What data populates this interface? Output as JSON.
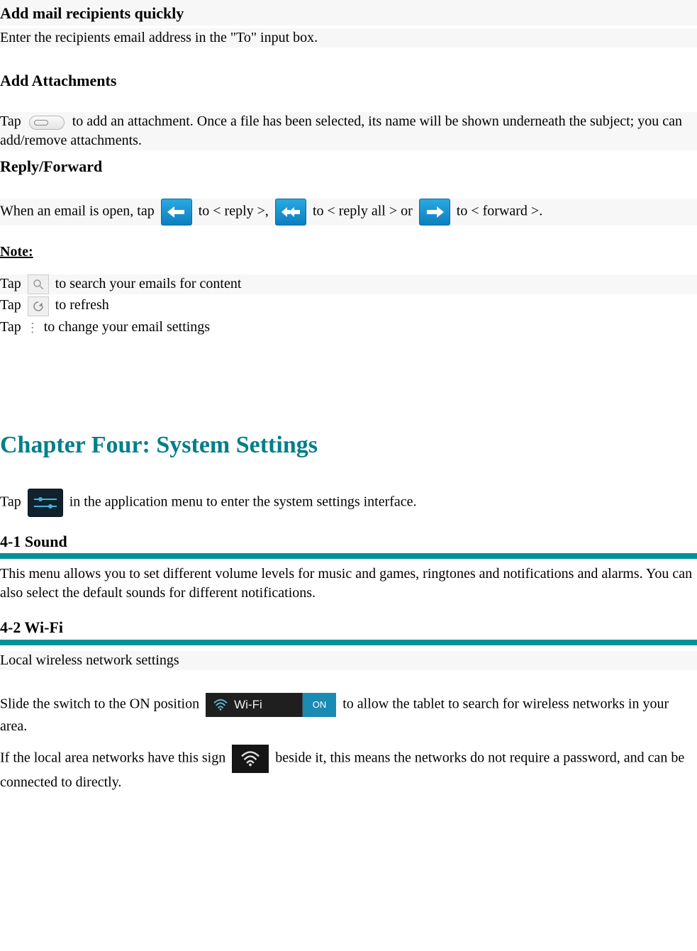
{
  "email": {
    "add_recipients_heading": "Add mail recipients quickly",
    "add_recipients_body": "Enter the recipients email address in the \"To\" input box.",
    "add_attachments_heading": "Add Attachments",
    "attach_pre": "Tap ",
    "attach_post": " to add an attachment. Once a file has been selected, its name will be shown underneath the subject; you can add/remove attachments.",
    "reply_forward_heading": "Reply/Forward",
    "reply_pre": "When an email is open, tap ",
    "reply_mid1": " to < reply >, ",
    "reply_mid2": " to < reply all > or ",
    "reply_post": " to < forward >.",
    "note_heading": "Note:",
    "note_search_pre": "Tap ",
    "note_search_post": " to search your emails for content",
    "note_refresh_pre": "Tap ",
    "note_refresh_post": " to refresh",
    "note_settings_pre": "Tap ",
    "note_settings_post": " to change your email settings"
  },
  "chapter": {
    "title": "Chapter Four: System Settings",
    "intro_pre": "Tap ",
    "intro_post": " in the application menu to enter the system settings interface.",
    "sound_heading": "4-1 Sound",
    "sound_body": "This menu allows you to set different volume levels for music and games, ringtones and notifications and alarms.    You can also select the default sounds for different notifications.",
    "wifi_heading": "4-2 Wi-Fi",
    "wifi_subtitle": "Local wireless network settings",
    "wifi_slide_pre": "Slide the switch to the ON position ",
    "wifi_slide_post": " to allow the tablet to search for wireless networks in your area.",
    "wifi_bar_label": "Wi-Fi",
    "wifi_bar_on": "ON",
    "wifi_open_pre": "If the local area networks have this sign ",
    "wifi_open_post": " beside it, this means the networks do not require a password, and can be connected to directly."
  }
}
